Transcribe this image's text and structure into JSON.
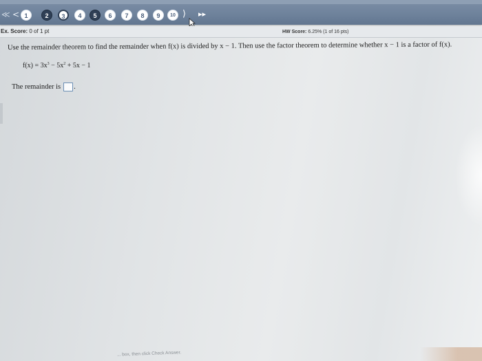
{
  "nav": {
    "items": [
      {
        "label": "1",
        "state": "done"
      },
      {
        "label": "2",
        "state": "open"
      },
      {
        "label": "3",
        "state": "current"
      },
      {
        "label": "4",
        "state": "done"
      },
      {
        "label": "5",
        "state": "open"
      },
      {
        "label": "6",
        "state": "done"
      },
      {
        "label": "7",
        "state": "done"
      },
      {
        "label": "8",
        "state": "done"
      },
      {
        "label": "9",
        "state": "done"
      },
      {
        "label": "10",
        "state": "done"
      }
    ],
    "back_all_icon": "double-chevron-left-icon",
    "back_icon": "chevron-left-icon",
    "next_icon": "chevron-right-icon",
    "next_all_icon": "double-chevron-right-icon",
    "back_all_glyph": "≪",
    "back_glyph": "<",
    "next_glyph": "⟩",
    "next_all_glyph": "▸▸"
  },
  "scores": {
    "ex_label": "Ex. Score:",
    "ex_value": "0 of 1 pt",
    "hw_label": "HW Score:",
    "hw_value": "6.25% (1 of 16 pts)"
  },
  "question": {
    "prompt": "Use the remainder theorem to find the remainder when f(x) is divided by x − 1. Then use the factor theorem to determine whether x − 1 is a factor of f(x).",
    "function_prefix": "f(x) = 3x",
    "exp1": "3",
    "term2": " − 5x",
    "exp2": "2",
    "term3": " + 5x − 1",
    "answer_label": "The remainder is",
    "answer_value": "",
    "answer_suffix": "."
  },
  "footer": {
    "hint": "... box, then click Check Answer."
  },
  "colors": {
    "nav_bar": "#6f839c",
    "answer_border": "#6b8fb5"
  }
}
